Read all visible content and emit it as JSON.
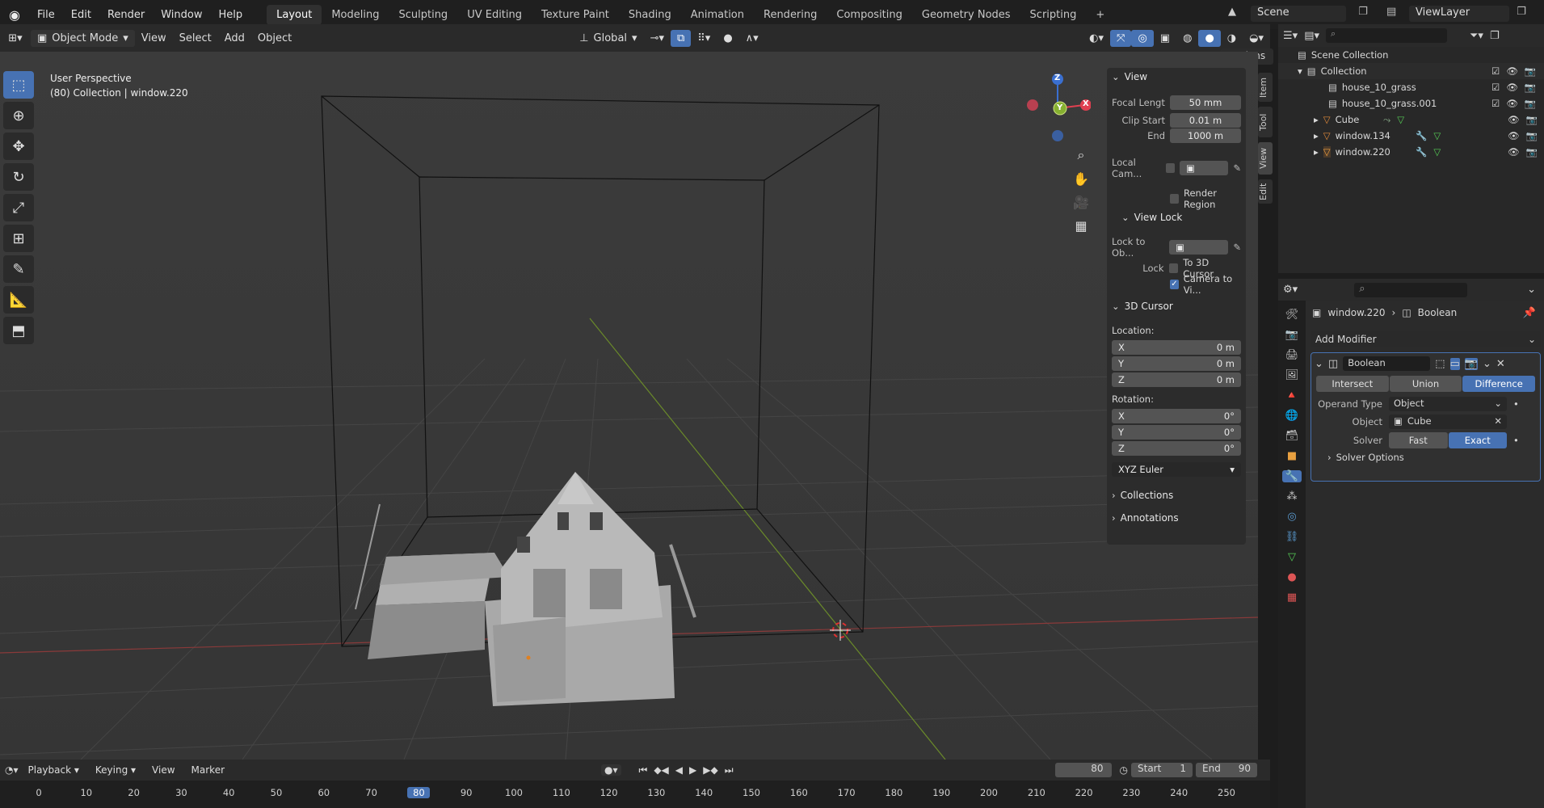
{
  "topbar": {
    "menus": [
      "File",
      "Edit",
      "Render",
      "Window",
      "Help"
    ],
    "workspaces": [
      "Layout",
      "Modeling",
      "Sculpting",
      "UV Editing",
      "Texture Paint",
      "Shading",
      "Animation",
      "Rendering",
      "Compositing",
      "Geometry Nodes",
      "Scripting"
    ],
    "active_workspace": "Layout",
    "add_tab": "+",
    "scene": "Scene",
    "view_layer": "ViewLayer"
  },
  "viewport_header": {
    "mode": "Object Mode",
    "menus": [
      "View",
      "Select",
      "Add",
      "Object"
    ],
    "orientation": "Global",
    "options": "Options"
  },
  "viewport": {
    "perspective": "User Perspective",
    "info": "(80) Collection | window.220",
    "gizmo_axes": [
      "Z",
      "Y",
      "X"
    ]
  },
  "sidebar_tabs": [
    "Item",
    "Tool",
    "View",
    "Edit"
  ],
  "npanel": {
    "view_section": "View",
    "focal_label": "Focal Lengt",
    "focal_value": "50 mm",
    "clip_start_label": "Clip Start",
    "clip_start_value": "0.01 m",
    "end_label": "End",
    "end_value": "1000 m",
    "local_cam_label": "Local Cam...",
    "render_region": "Render Region",
    "view_lock_section": "View Lock",
    "lock_to_label": "Lock to Ob...",
    "lock_label": "Lock",
    "to_3d_cursor": "To 3D Cursor",
    "camera_to_view": "Camera to Vi...",
    "cursor_section": "3D Cursor",
    "location_label": "Location:",
    "loc_x": "0 m",
    "loc_y": "0 m",
    "loc_z": "0 m",
    "rotation_label": "Rotation:",
    "rot_x": "0°",
    "rot_y": "0°",
    "rot_z": "0°",
    "axis_x": "X",
    "axis_y": "Y",
    "axis_z": "Z",
    "rotation_mode": "XYZ Euler",
    "collections": "Collections",
    "annotations": "Annotations"
  },
  "outliner": {
    "root": "Scene Collection",
    "collection": "Collection",
    "items": [
      "house_10_grass",
      "house_10_grass.001",
      "Cube",
      "window.134",
      "window.220"
    ]
  },
  "properties": {
    "object_name": "window.220",
    "breadcrumb_target": "Boolean",
    "add_modifier": "Add Modifier",
    "modifier_name": "Boolean",
    "ops": [
      "Intersect",
      "Union",
      "Difference"
    ],
    "active_op": "Difference",
    "operand_type_label": "Operand Type",
    "operand_type_value": "Object",
    "object_label": "Object",
    "object_value": "Cube",
    "solver_label": "Solver",
    "solver_fast": "Fast",
    "solver_exact": "Exact",
    "solver_options": "Solver Options"
  },
  "timeline": {
    "menus": [
      "Playback",
      "Keying",
      "View",
      "Marker"
    ],
    "current_frame": "80",
    "start_label": "Start",
    "start_value": "1",
    "end_label": "End",
    "end_value": "90",
    "ticks": [
      "0",
      "10",
      "20",
      "30",
      "40",
      "50",
      "60",
      "70",
      "80",
      "90",
      "100",
      "110",
      "120",
      "130",
      "140",
      "150",
      "160",
      "170",
      "180",
      "190",
      "200",
      "210",
      "220",
      "230",
      "240",
      "250"
    ]
  }
}
